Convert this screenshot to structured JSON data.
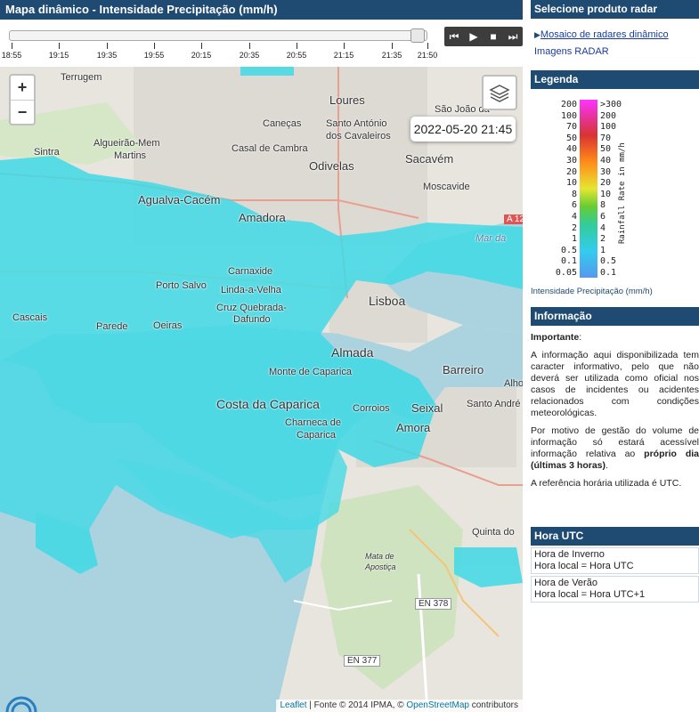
{
  "left_title": "Mapa dinâmico - Intensidade Precipitação (mm/h)",
  "timeline": {
    "labels": [
      "18:55",
      "19:15",
      "19:35",
      "19:55",
      "20:15",
      "20:35",
      "20:55",
      "21:15",
      "21:35",
      "21:50"
    ],
    "selected": "21:45"
  },
  "controls": {
    "rewind": "⏮",
    "play": "▶",
    "stop": "■",
    "forward": "⏭"
  },
  "map": {
    "zoom_in": "+",
    "zoom_out": "−",
    "datetime": "2022-05-20 21:45",
    "places": {
      "loures": "Loures",
      "terrugem": "Terrugem",
      "sao_joao": "São João da",
      "santo_antonio_1": "Santo António",
      "santo_antonio_2": "dos Cavaleiros",
      "canecas": "Caneças",
      "algueirao_1": "Algueirão-Mem",
      "algueirao_2": "Martins",
      "casal": "Casal de Cambra",
      "odivelas": "Odivelas",
      "sacavem": "Sacavém",
      "moscavide": "Moscavide",
      "sintra": "Sintra",
      "agualva": "Agualva-Cacém",
      "amadora": "Amadora",
      "mar_da": "Mar da",
      "carnaxide": "Carnaxide",
      "porto_salvo": "Porto Salvo",
      "linda": "Linda-a-Velha",
      "cruz_1": "Cruz Quebrada-",
      "cruz_2": "Dafundo",
      "cascais": "Cascais",
      "parede": "Parede",
      "oeiras": "Oeiras",
      "lisboa": "Lisboa",
      "almada": "Almada",
      "barreiro": "Barreiro",
      "alho": "Alho",
      "monte": "Monte de Caparica",
      "costa": "Costa da Caparica",
      "corroios": "Corroios",
      "seixal": "Seixal",
      "santo_andre": "Santo André",
      "charneca_1": "Charneca de",
      "charneca_2": "Caparica",
      "amora": "Amora",
      "quinta": "Quinta do",
      "mata_1": "Mata de",
      "mata_2": "Apostiça",
      "en378": "EN 378",
      "en377": "EN 377",
      "a12": "A 12"
    },
    "attribution": {
      "leaflet": "Leaflet",
      "source": " | Fonte © 2014 IPMA, © ",
      "osm": "OpenStreetMap",
      "contributors": " contributors"
    }
  },
  "sidebar": {
    "product_title": "Selecione produto radar",
    "link_mosaic": "Mosaico de radares dinâmico",
    "link_images": "Imagens RADAR",
    "legend_title": "Legenda",
    "legend_left": [
      "200",
      "100",
      "70",
      "50",
      "40",
      "30",
      "20",
      "10",
      "8",
      "6",
      "4",
      "2",
      "1",
      "0.5",
      "0.1",
      "0.05"
    ],
    "legend_right": [
      ">300",
      "200",
      "100",
      "70",
      "50",
      "40",
      "30",
      "20",
      "10",
      "8",
      "6",
      "4",
      "2",
      "1",
      "0.5",
      "0.1"
    ],
    "legend_axis": "Rainfall Rate in mm/h",
    "legend_caption": "Intensidade Precipitação (mm/h)",
    "info_title": "Informação",
    "important_label": "Importante",
    "important_colon": ":",
    "info_p1": "A informação aqui disponibilizada tem caracter informativo, pelo que não deverá ser utilizada como oficial nos casos de incidentes ou acidentes relacionados com condições meteorológicas.",
    "info_p2_a": "Por motivo de gestão do volume de informação só estará acessível informação relativa ao ",
    "info_p2_b": "próprio dia (últimas 3 horas)",
    "info_p2_c": ".",
    "info_p3": "A referência horária utilizada é UTC.",
    "utc_title": "Hora UTC",
    "winter_label": "Hora de Inverno",
    "winter_value": "Hora local = Hora UTC",
    "summer_label": "Hora de Verão",
    "summer_value": "Hora local = Hora UTC+1"
  },
  "colors": {
    "header": "#1f4a72",
    "radar": "#3fd9e6",
    "water": "#aad3df",
    "link": "#1a3b9c"
  }
}
